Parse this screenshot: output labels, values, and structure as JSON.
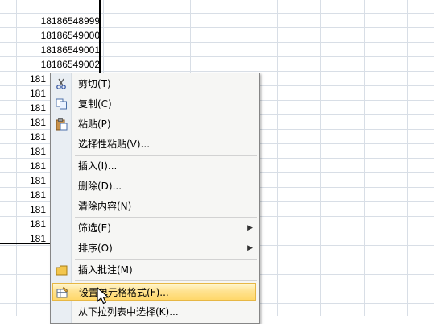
{
  "sheet": {
    "cells": [
      "18186548999",
      "18186549000",
      "18186549001",
      "18186549002",
      "181",
      "181",
      "181",
      "181",
      "181",
      "181",
      "181",
      "181",
      "181",
      "181",
      "181",
      "181"
    ]
  },
  "context_menu": {
    "items": {
      "cut": "剪切(T)",
      "copy": "复制(C)",
      "paste": "粘贴(P)",
      "paste_special": "选择性粘贴(V)...",
      "insert": "插入(I)...",
      "delete": "删除(D)...",
      "clear_contents": "清除内容(N)",
      "filter": "筛选(E)",
      "sort": "排序(O)",
      "insert_comment": "插入批注(M)",
      "format_cells": "设置单元格格式(F)...",
      "pick_from_list": "从下拉列表中选择(K)..."
    },
    "highlight_color": "#ffe391",
    "icons": {
      "cut": "scissors-icon",
      "copy": "copy-icon",
      "paste": "paste-icon",
      "insert_comment": "comment-icon",
      "format_cells": "format-cells-icon"
    }
  }
}
